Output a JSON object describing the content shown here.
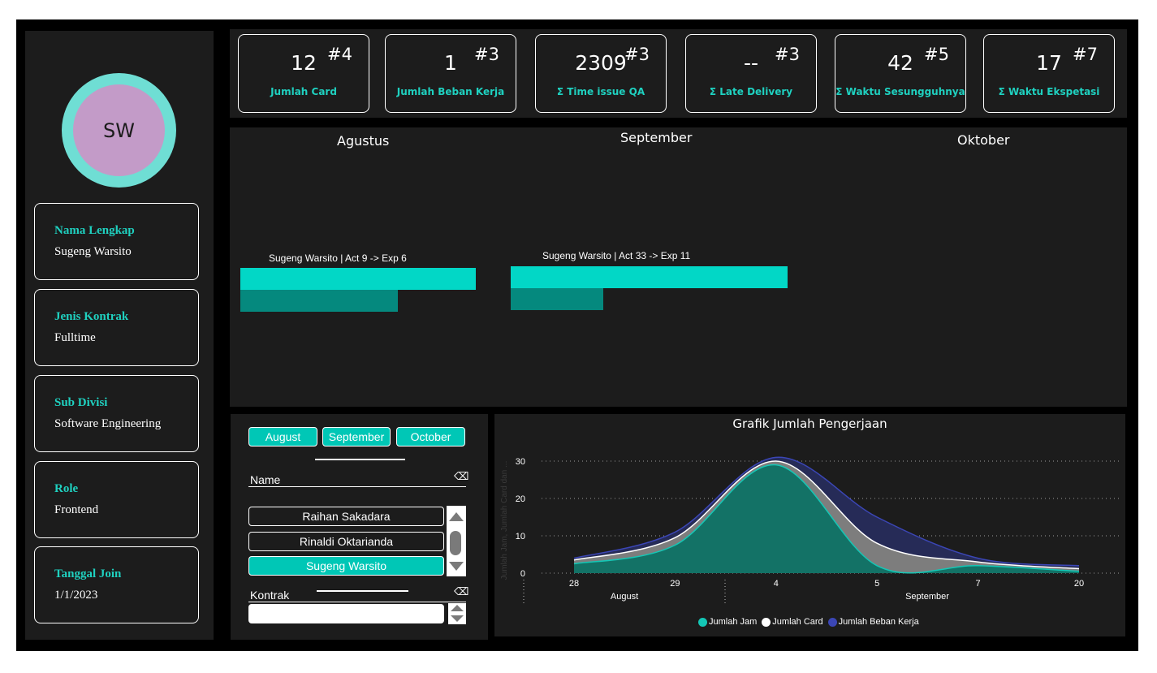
{
  "profile": {
    "initials": "SW",
    "fields": [
      {
        "label": "Nama Lengkap",
        "value": "Sugeng Warsito"
      },
      {
        "label": "Jenis Kontrak",
        "value": "Fulltime"
      },
      {
        "label": "Sub Divisi",
        "value": "Software Engineering"
      },
      {
        "label": "Role",
        "value": "Frontend"
      },
      {
        "label": "Tanggal Join",
        "value": "1/1/2023"
      }
    ]
  },
  "kpis": [
    {
      "value": "12",
      "rank": "#4",
      "label": "Jumlah Card"
    },
    {
      "value": "1",
      "rank": "#3",
      "label": "Jumlah Beban Kerja"
    },
    {
      "value": "2309",
      "rank": "#3",
      "label": "Σ Time issue QA"
    },
    {
      "value": "--",
      "rank": "#3",
      "label": "Σ Late Delivery"
    },
    {
      "value": "42",
      "rank": "#5",
      "label": "Σ Waktu Sesungguhnya"
    },
    {
      "value": "17",
      "rank": "#7",
      "label": "Σ Waktu Ekspetasi"
    }
  ],
  "months": {
    "titles": [
      "Agustus",
      "September",
      "Oktober"
    ],
    "bars": [
      {
        "caption": "Sugeng Warsito | Act 9 -> Exp 6",
        "act": 9,
        "exp": 6
      },
      {
        "caption": "Sugeng Warsito | Act 33 -> Exp 11",
        "act": 33,
        "exp": 11
      }
    ]
  },
  "filters": {
    "month_buttons": [
      "August",
      "September",
      "October"
    ],
    "name_header": "Name",
    "names": [
      "Raihan Sakadara",
      "Rinaldi Oktarianda",
      "Sugeng Warsito"
    ],
    "selected_name": "Sugeng Warsito",
    "kontrak_header": "Kontrak",
    "kontrak_value": ""
  },
  "chart_data": {
    "type": "area",
    "title": "Grafik Jumlah Pengerjaan",
    "ylabel": "Jumlah Jam, Jumlah Card dan ...",
    "ylim": [
      0,
      32
    ],
    "yticks": [
      0,
      10,
      20,
      30
    ],
    "x": [
      "28",
      "29",
      "4",
      "5",
      "7",
      "20"
    ],
    "x_groups": [
      "August",
      "September"
    ],
    "series": [
      {
        "name": "Jumlah Beban Kerja",
        "color": "#2f3472",
        "values": [
          4,
          11,
          31,
          15,
          4,
          2
        ]
      },
      {
        "name": "Jumlah Card",
        "color": "#ffffff",
        "values": [
          3.5,
          9.5,
          30,
          8,
          3,
          1.2
        ]
      },
      {
        "name": "Jumlah Jam",
        "color": "#14c7b6",
        "values": [
          2.5,
          7.5,
          29,
          2,
          2,
          0.5
        ]
      }
    ],
    "legend": "bottom-center",
    "grid": true
  }
}
